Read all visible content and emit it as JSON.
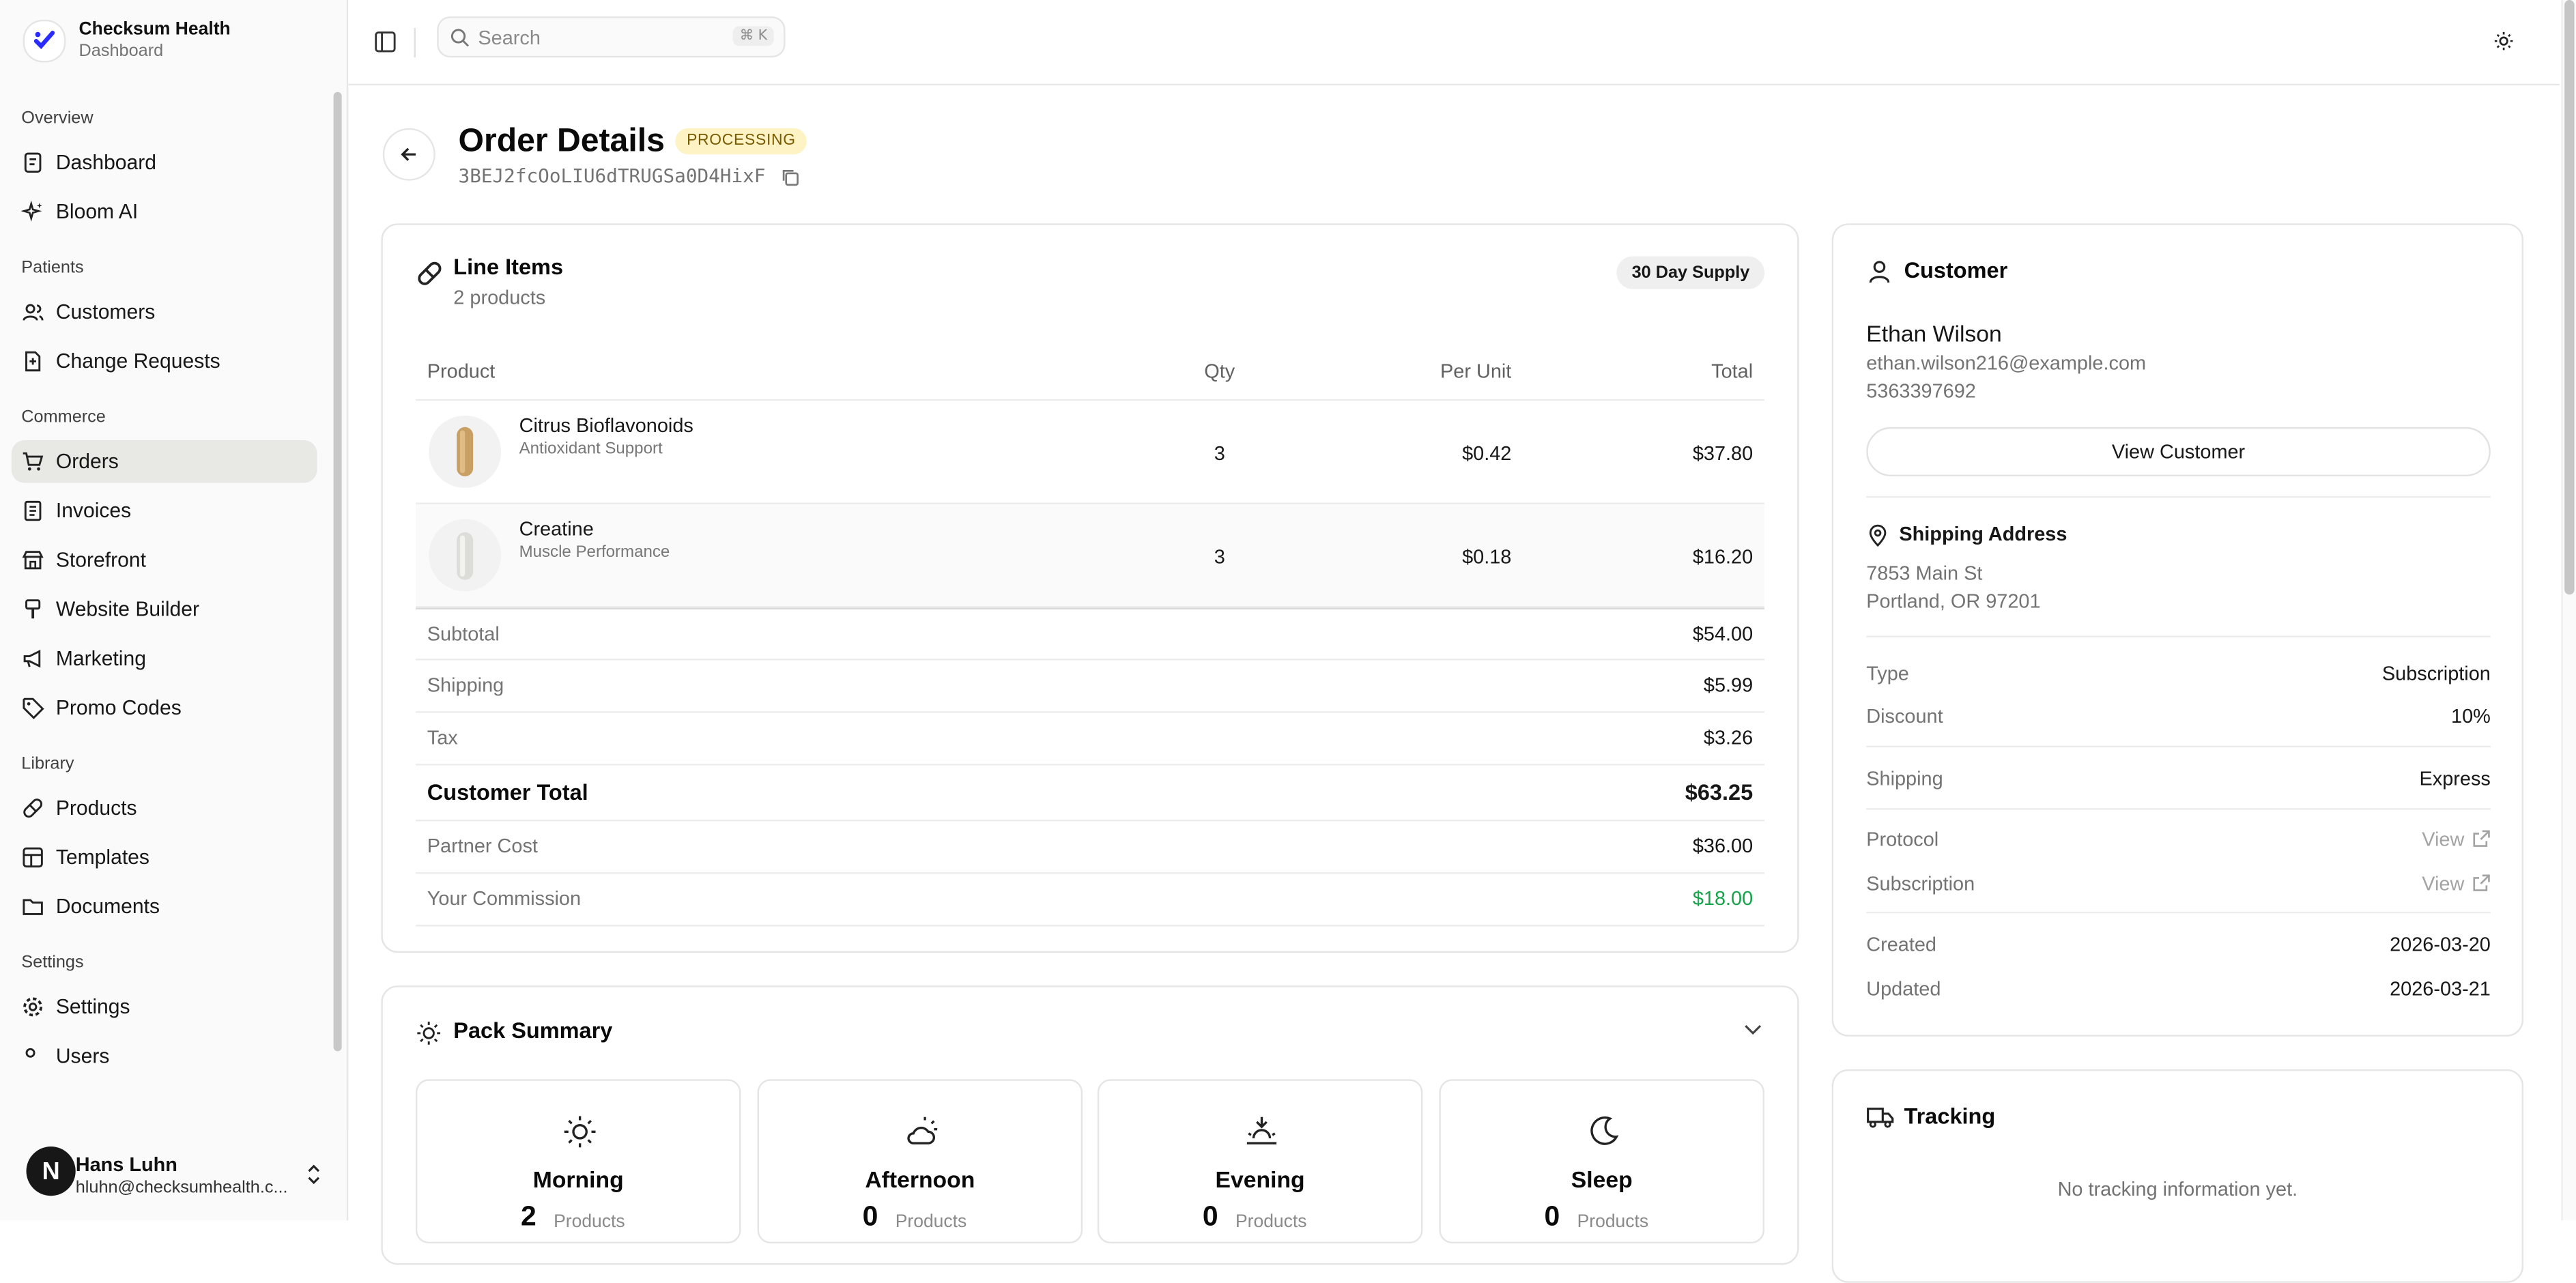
{
  "brand": {
    "name": "Checksum Health",
    "subtitle": "Dashboard"
  },
  "nav": {
    "overview": {
      "title": "Overview",
      "dashboard": "Dashboard",
      "bloom": "Bloom AI"
    },
    "patients": {
      "title": "Patients",
      "customers": "Customers",
      "change_requests": "Change Requests"
    },
    "commerce": {
      "title": "Commerce",
      "orders": "Orders",
      "invoices": "Invoices",
      "storefront": "Storefront",
      "website_builder": "Website Builder",
      "marketing": "Marketing",
      "promo_codes": "Promo Codes"
    },
    "library": {
      "title": "Library",
      "products": "Products",
      "templates": "Templates",
      "documents": "Documents"
    },
    "settings": {
      "title": "Settings",
      "settings": "Settings",
      "users": "Users"
    }
  },
  "user": {
    "initial": "N",
    "name": "Hans Luhn",
    "email": "hluhn@checksumhealth.c..."
  },
  "search": {
    "placeholder": "Search",
    "shortcut": "⌘ K"
  },
  "order": {
    "title": "Order Details",
    "status": "PROCESSING",
    "id": "3BEJ2fcOoLIU6dTRUGSa0D4HixF"
  },
  "line_items": {
    "title": "Line Items",
    "count": "2 products",
    "supply": "30 Day Supply",
    "columns": {
      "product": "Product",
      "qty": "Qty",
      "per_unit": "Per Unit",
      "total": "Total"
    },
    "rows": [
      {
        "name": "Citrus Bioflavonoids",
        "category": "Antioxidant Support",
        "qty": "3",
        "per_unit": "$0.42",
        "total": "$37.80"
      },
      {
        "name": "Creatine",
        "category": "Muscle Performance",
        "qty": "3",
        "per_unit": "$0.18",
        "total": "$16.20"
      }
    ],
    "summary": {
      "subtotal_label": "Subtotal",
      "subtotal": "$54.00",
      "shipping_label": "Shipping",
      "shipping": "$5.99",
      "tax_label": "Tax",
      "tax": "$3.26",
      "customer_total_label": "Customer Total",
      "customer_total": "$63.25",
      "partner_cost_label": "Partner Cost",
      "partner_cost": "$36.00",
      "commission_label": "Your Commission",
      "commission": "$18.00"
    }
  },
  "pack_summary": {
    "title": "Pack Summary",
    "slots": [
      {
        "name": "Morning",
        "count": "2",
        "unit": "Products"
      },
      {
        "name": "Afternoon",
        "count": "0",
        "unit": "Products"
      },
      {
        "name": "Evening",
        "count": "0",
        "unit": "Products"
      },
      {
        "name": "Sleep",
        "count": "0",
        "unit": "Products"
      }
    ]
  },
  "customer": {
    "title": "Customer",
    "name": "Ethan Wilson",
    "email": "ethan.wilson216@example.com",
    "phone": "5363397692",
    "view_button": "View Customer",
    "shipping_title": "Shipping Address",
    "address_line1": "7853 Main St",
    "address_line2": "Portland, OR 97201",
    "type_label": "Type",
    "type": "Subscription",
    "discount_label": "Discount",
    "discount": "10%",
    "shipping_label": "Shipping",
    "shipping": "Express",
    "protocol_label": "Protocol",
    "protocol_link": "View",
    "subscription_label": "Subscription",
    "subscription_link": "View",
    "created_label": "Created",
    "created": "2026-03-20",
    "updated_label": "Updated",
    "updated": "2026-03-21"
  },
  "tracking": {
    "title": "Tracking",
    "empty": "No tracking information yet."
  },
  "colors": {
    "accent": "#2a2cff",
    "commission": "#16a34a",
    "status_bg": "#fdf3c4",
    "active_nav": "#e8e9e5"
  }
}
